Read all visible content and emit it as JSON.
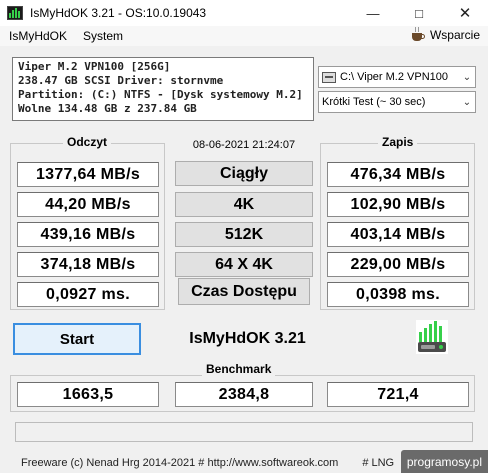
{
  "window": {
    "title": "IsMyHdOK 3.21 - OS:10.0.19043"
  },
  "menu": {
    "items": [
      "IsMyHdOK",
      "System"
    ],
    "help": "Wsparcie"
  },
  "info": {
    "line1": "Viper M.2 VPN100 [256G]",
    "line2": "238.47 GB  SCSI Driver: stornvme",
    "line3": "Partition: (C:) NTFS - [Dysk systemowy M.2]",
    "line4": "Wolne 134.48 GB z 237.84 GB"
  },
  "selects": {
    "drive": "C:\\ Viper M.2 VPN100",
    "test": "Krótki Test (~ 30 sec)"
  },
  "read": {
    "label": "Odczyt",
    "values": [
      "1377,64 MB/s",
      "44,20 MB/s",
      "439,16 MB/s",
      "374,18 MB/s",
      "0,0927 ms."
    ]
  },
  "write": {
    "label": "Zapis",
    "values": [
      "476,34 MB/s",
      "102,90 MB/s",
      "403,14 MB/s",
      "229,00 MB/s",
      "0,0398 ms."
    ]
  },
  "datetime": "08-06-2021 21:24:07",
  "modes": [
    "Ciągły",
    "4K",
    "512K",
    "64 X 4K",
    "Czas Dostępu"
  ],
  "start_label": "Start",
  "app_name": "IsMyHdOK 3.21",
  "benchmark": {
    "label": "Benchmark",
    "values": [
      "1663,5",
      "2384,8",
      "721,4"
    ]
  },
  "footer": {
    "text": "Freeware (c) Nenad Hrg 2014-2021 # http://www.softwareok.com",
    "lng": "# LNG"
  },
  "watermark": "programosy.pl",
  "colors": {
    "accent": "#3a8ee0",
    "logo_green": "#36d04a"
  }
}
